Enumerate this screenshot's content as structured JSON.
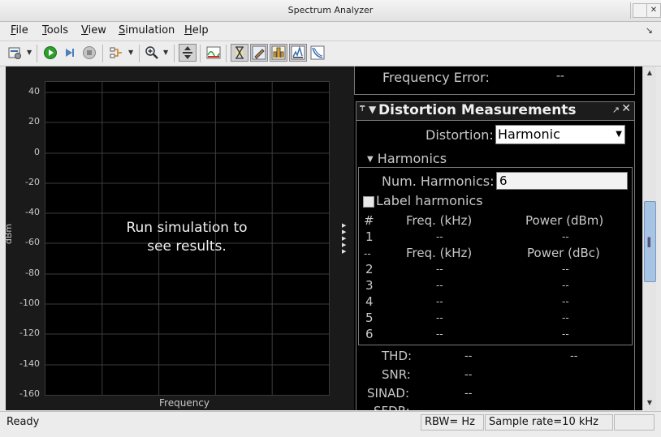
{
  "window": {
    "title": "Spectrum Analyzer"
  },
  "menu": {
    "items": [
      {
        "name": "menu-file",
        "access": "F",
        "rest": "ile"
      },
      {
        "name": "menu-tools",
        "access": "T",
        "rest": "ools"
      },
      {
        "name": "menu-view",
        "access": "V",
        "rest": "iew"
      },
      {
        "name": "menu-simulation",
        "access": "S",
        "rest": "imulation"
      },
      {
        "name": "menu-help",
        "access": "H",
        "rest": "elp"
      }
    ]
  },
  "plot": {
    "message_line1": "Run simulation to",
    "message_line2": "see results.",
    "xlabel": "Frequency",
    "ylabel": "dBm",
    "yticks": [
      "40",
      "20",
      "0",
      "-20",
      "-40",
      "-60",
      "-80",
      "-100",
      "-120",
      "-140",
      "-160"
    ],
    "ylim": [
      -160,
      40
    ],
    "grid": true,
    "background": "#000000",
    "grid_color": "#3c3c3c"
  },
  "panel": {
    "freq_error_label": "Frequency Error:",
    "freq_error_value": "--",
    "distortion_title": "Distortion Measurements",
    "distortion_label": "Distortion:",
    "distortion_value": "Harmonic",
    "harmonics_label": "Harmonics",
    "num_harmonics_label": "Num. Harmonics:",
    "num_harmonics_value": "6",
    "label_harmonics": "Label harmonics",
    "table": {
      "col_index": "#",
      "col_freq": "Freq. (kHz)",
      "col_power_dbm": "Power (dBm)",
      "col_sep": "--",
      "col_power_dbc": "Power (dBc)",
      "row1": {
        "index": "1",
        "freq": "--",
        "power": "--"
      },
      "rows": [
        {
          "index": "2",
          "freq": "--",
          "power": "--"
        },
        {
          "index": "3",
          "freq": "--",
          "power": "--"
        },
        {
          "index": "4",
          "freq": "--",
          "power": "--"
        },
        {
          "index": "5",
          "freq": "--",
          "power": "--"
        },
        {
          "index": "6",
          "freq": "--",
          "power": "--"
        }
      ]
    },
    "metrics": {
      "thd_label": "THD:",
      "thd_value1": "--",
      "thd_value2": "--",
      "snr_label": "SNR:",
      "snr_value": "--",
      "sinad_label": "SINAD:",
      "sinad_value": "--",
      "sfdr_label": "SFDR:"
    }
  },
  "status": {
    "ready": "Ready",
    "rbw": "RBW= Hz",
    "sample_rate": "Sample rate=10 kHz",
    "blank": ""
  }
}
